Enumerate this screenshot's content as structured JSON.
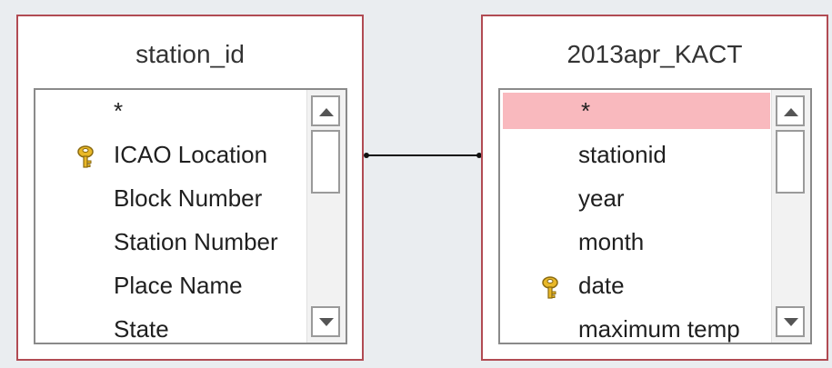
{
  "tables": {
    "left": {
      "title": "station_id",
      "fields": [
        {
          "label": "*",
          "key": false
        },
        {
          "label": "ICAO Location",
          "key": true
        },
        {
          "label": "Block Number",
          "key": false
        },
        {
          "label": "Station Number",
          "key": false
        },
        {
          "label": "Place Name",
          "key": false
        },
        {
          "label": "State",
          "key": false
        }
      ]
    },
    "right": {
      "title": "2013apr_KACT",
      "fields": [
        {
          "label": "*",
          "key": false,
          "selected": true
        },
        {
          "label": "stationid",
          "key": false
        },
        {
          "label": "year",
          "key": false
        },
        {
          "label": "month",
          "key": false
        },
        {
          "label": "date",
          "key": true
        },
        {
          "label": "maximum temp",
          "key": false
        }
      ]
    }
  },
  "icons": {
    "key": "key-icon",
    "scroll_up": "scroll-up-arrow-icon",
    "scroll_down": "scroll-down-arrow-icon"
  },
  "colors": {
    "border": "#b14b53",
    "selected_row": "#f9b9be",
    "background": "#eaedf0"
  }
}
